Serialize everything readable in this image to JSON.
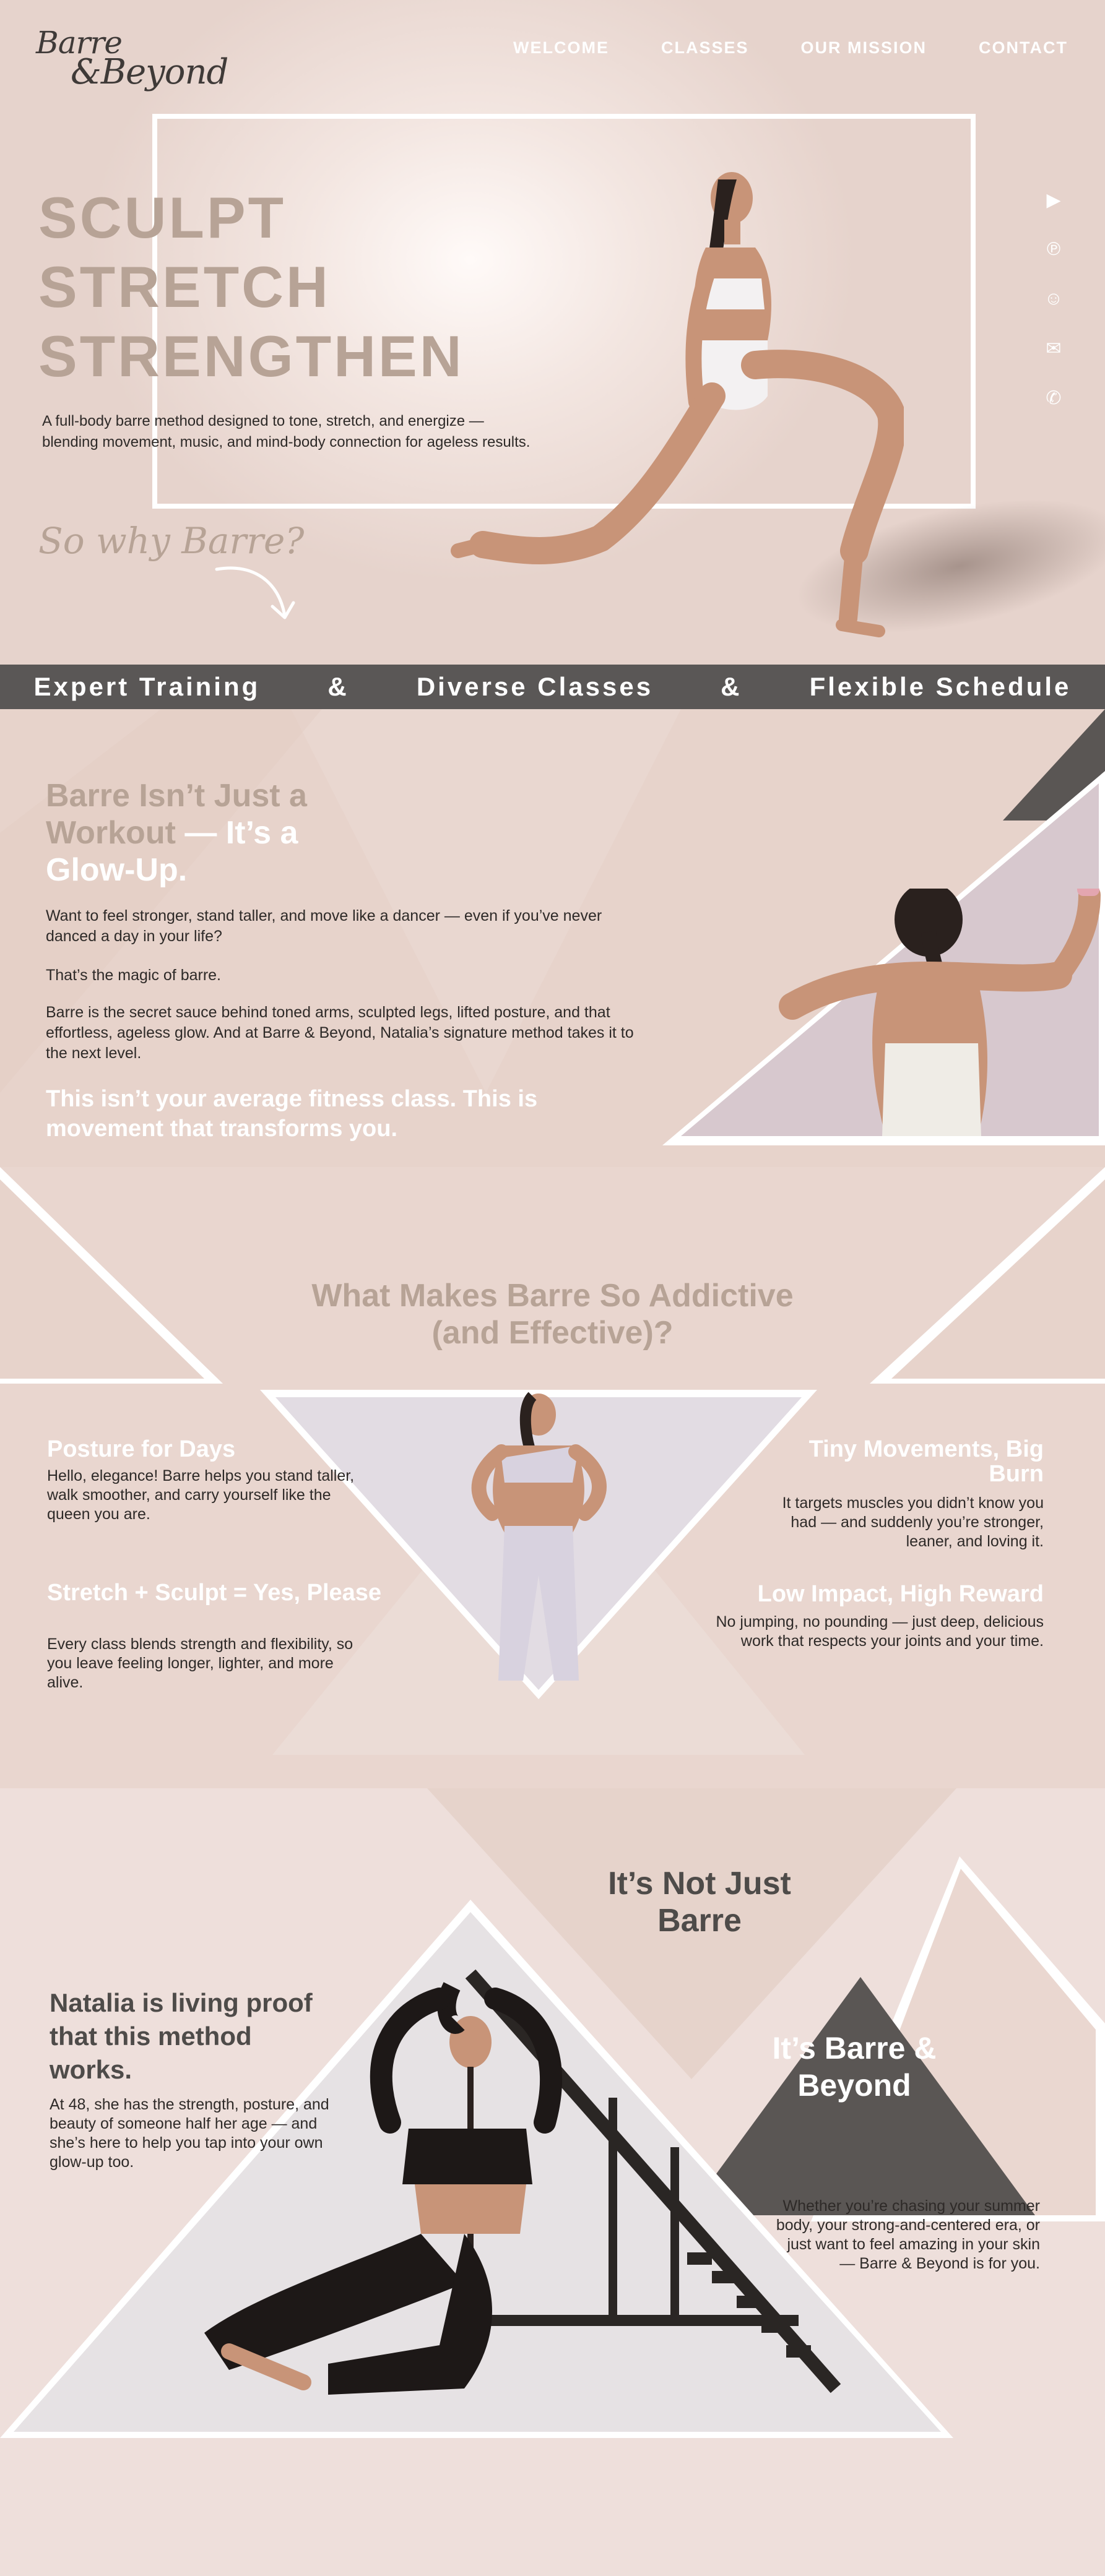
{
  "brand": {
    "logo_line1": "Barre",
    "logo_line2": "&Beyond"
  },
  "nav": {
    "items": [
      "WELCOME",
      "CLASSES",
      "OUR MISSION",
      "CONTACT"
    ]
  },
  "hero": {
    "headline": [
      "SCULPT",
      "STRETCH",
      "STRENGTHEN"
    ],
    "description_line1": "A full-body barre method designed to tone, stretch, and energize —",
    "description_line2": "blending movement, music, and mind-body connection for ageless results.",
    "why_text": "So why Barre?"
  },
  "social_icons": [
    "youtube-icon",
    "pinterest-icon",
    "snapchat-icon",
    "messenger-icon",
    "whatsapp-icon"
  ],
  "band": {
    "items": [
      "Expert Training",
      "&",
      "Diverse Classes",
      "&",
      "Flexible Schedule"
    ]
  },
  "intro": {
    "title_taupe": "Barre Isn’t Just a Workout",
    "title_white": "—  It’s a Glow-Up.",
    "p1": "Want to feel stronger, stand taller, and move like a dancer — even if you’ve never danced a day in your life?",
    "p2": "That’s the magic of barre.",
    "p3": "Barre is the secret sauce behind toned arms, sculpted legs, lifted posture, and that effortless, ageless glow. And at Barre & Beyond, Natalia’s signature method takes it to the next level.",
    "closing": "This isn’t your average fitness class. This is movement that transforms you."
  },
  "addictive": {
    "title_line1": "What Makes Barre So Addictive",
    "title_line2": "(and Effective)?",
    "features": [
      {
        "title": "Posture for Days",
        "text": "Hello, elegance! Barre helps you stand taller, walk smoother, and carry yourself like the queen you are."
      },
      {
        "title": "Stretch + Sculpt = Yes, Please",
        "text": "Every class blends strength and flexibility, so you leave feeling longer, lighter, and more alive."
      },
      {
        "title": "Tiny Movements, Big Burn",
        "text": "It targets muscles you didn’t know you had — and suddenly you’re stronger, leaner, and loving it."
      },
      {
        "title": "Low Impact, High Reward",
        "text": "No jumping, no pounding — just deep, delicious work that respects your joints and your time."
      }
    ]
  },
  "beyond": {
    "natalia_title": "Natalia is living proof that this method works.",
    "natalia_text": "At 48, she has the strength, posture, and beauty of someone half her age — and she’s here to help you tap into your own glow-up too.",
    "not_just": "It’s Not Just Barre",
    "its_beyond": "It’s Barre & Beyond",
    "closing": "Whether you’re chasing your summer body, your strong-and-centered era, or just want to feel amazing in your skin — Barre & Beyond is for you."
  },
  "colors": {
    "taupe": "#b7a396",
    "band": "#5a5756",
    "blush": "#e7d3cb",
    "dark_triangle": "#5a5654"
  }
}
